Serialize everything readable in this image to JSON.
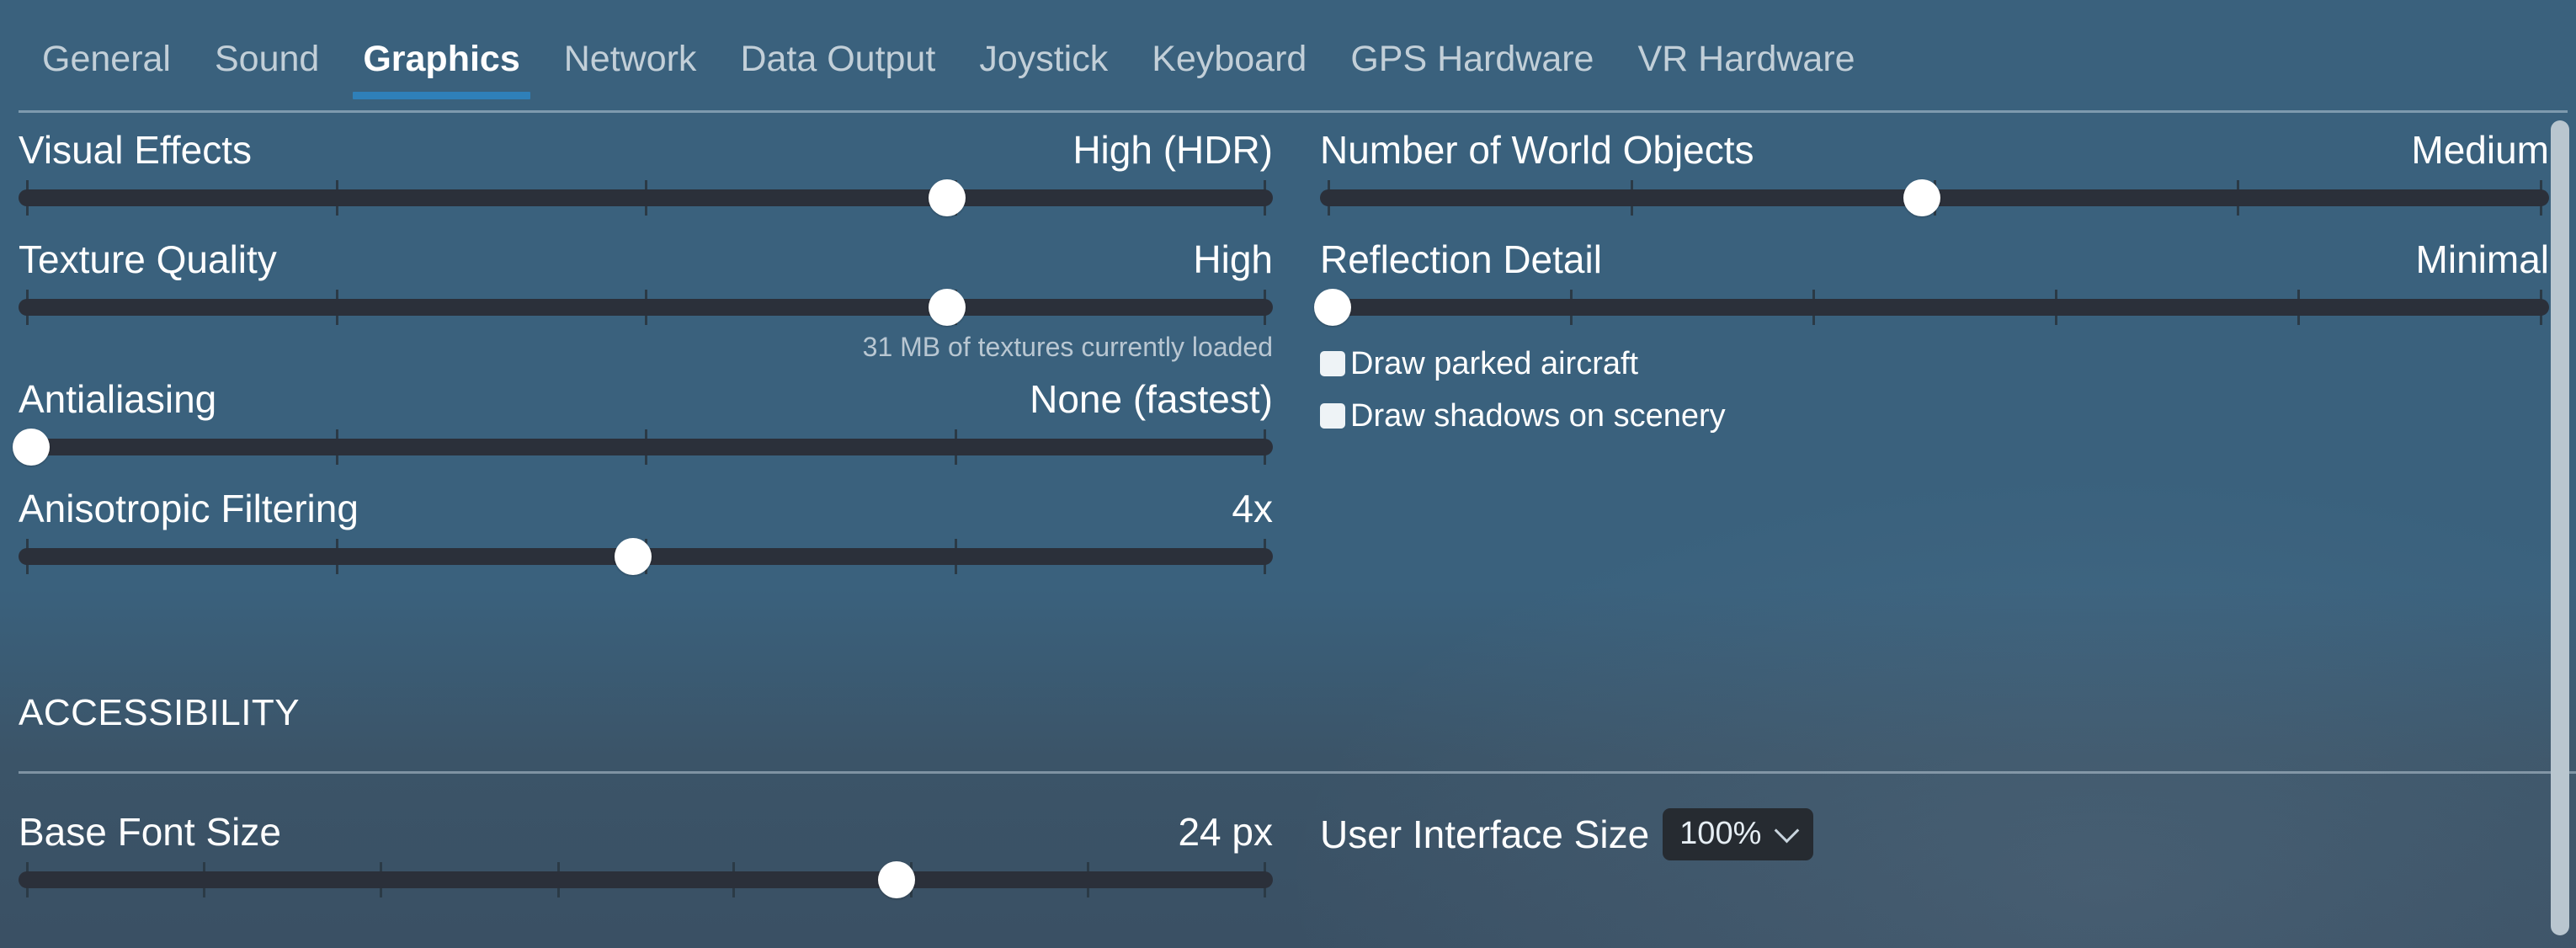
{
  "tabs": [
    {
      "label": "General",
      "active": false
    },
    {
      "label": "Sound",
      "active": false
    },
    {
      "label": "Graphics",
      "active": true
    },
    {
      "label": "Network",
      "active": false
    },
    {
      "label": "Data Output",
      "active": false
    },
    {
      "label": "Joystick",
      "active": false
    },
    {
      "label": "Keyboard",
      "active": false
    },
    {
      "label": "GPS Hardware",
      "active": false
    },
    {
      "label": "VR Hardware",
      "active": false
    }
  ],
  "graphics": {
    "left_sliders": [
      {
        "label": "Visual Effects",
        "value_text": "High (HDR)",
        "thumb_percent": 74,
        "tick_percents": [
          0,
          25,
          50,
          75,
          100
        ],
        "note": ""
      },
      {
        "label": "Texture Quality",
        "value_text": "High",
        "thumb_percent": 74,
        "tick_percents": [
          0,
          25,
          50,
          75,
          100
        ],
        "note": "31 MB of textures currently loaded"
      },
      {
        "label": "Antialiasing",
        "value_text": "None (fastest)",
        "thumb_percent": 1,
        "tick_percents": [
          0,
          25,
          50,
          75,
          100
        ],
        "note": ""
      },
      {
        "label": "Anisotropic Filtering",
        "value_text": "4x",
        "thumb_percent": 49,
        "tick_percents": [
          0,
          25,
          50,
          75,
          100
        ],
        "note": ""
      }
    ],
    "right_sliders": [
      {
        "label": "Number of World Objects",
        "value_text": "Medium",
        "thumb_percent": 49,
        "tick_percents": [
          0,
          25,
          50,
          75,
          100
        ]
      },
      {
        "label": "Reflection Detail",
        "value_text": "Minimal",
        "thumb_percent": 1,
        "tick_percents": [
          0,
          20,
          40,
          60,
          80,
          100
        ]
      }
    ],
    "checkboxes": [
      {
        "label": "Draw parked aircraft",
        "checked": false
      },
      {
        "label": "Draw shadows on scenery",
        "checked": false
      }
    ]
  },
  "accessibility": {
    "title": "ACCESSIBILITY",
    "base_font_size": {
      "label": "Base Font Size",
      "value_text": "24 px",
      "thumb_percent": 70,
      "tick_percents": [
        0,
        14.3,
        28.6,
        42.9,
        57.1,
        71.4,
        85.7,
        100
      ]
    },
    "ui_size": {
      "label": "User Interface Size",
      "value": "100%",
      "chevron_icon": "chevron-down-icon"
    }
  },
  "colors": {
    "background_top": "#3a617d",
    "background_bottom": "#3a5064",
    "accent": "#2f80b9",
    "track": "#2b303a",
    "thumb": "#ffffff",
    "muted_text": "#b9c7d2",
    "tab_inactive_text": "#c2cfd8",
    "scrollbar": "#b9c6cf",
    "dropdown_bg": "#262b31"
  },
  "scrollbar": {
    "name": "vertical-scrollbar",
    "position_percent": 0
  }
}
